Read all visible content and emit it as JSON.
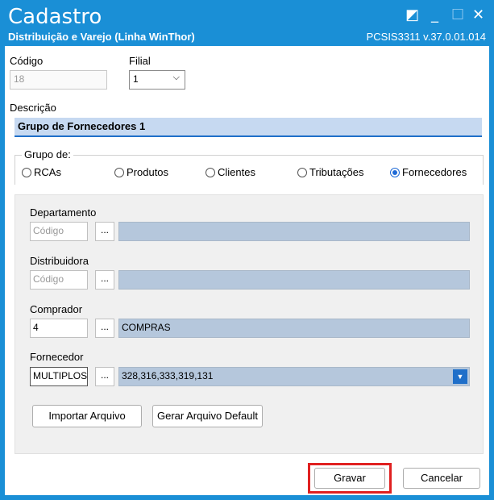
{
  "window": {
    "title": "Cadastro",
    "subtitle": "Distribuição e Varejo (Linha WinThor)",
    "version": "PCSIS3311  v.37.0.01.014"
  },
  "form": {
    "codigo_label": "Código",
    "codigo_value": "18",
    "filial_label": "Filial",
    "filial_value": "1",
    "descricao_label": "Descrição",
    "descricao_value": "Grupo  de Fornecedores 1",
    "grupo_label": "Grupo de:",
    "radios": [
      {
        "label": "RCAs",
        "checked": false
      },
      {
        "label": "Produtos",
        "checked": false
      },
      {
        "label": "Clientes",
        "checked": false
      },
      {
        "label": "Tributações",
        "checked": false
      },
      {
        "label": "Fornecedores",
        "checked": true
      }
    ]
  },
  "panel": {
    "departamento_label": "Departamento",
    "departamento_code_placeholder": "Código",
    "departamento_name": "",
    "distribuidora_label": "Distribuidora",
    "distribuidora_code_placeholder": "Código",
    "distribuidora_name": "",
    "comprador_label": "Comprador",
    "comprador_code": "4",
    "comprador_name": "COMPRAS",
    "fornecedor_label": "Fornecedor",
    "fornecedor_code": "MULTIPLOS",
    "fornecedor_name": "328,316,333,319,131",
    "dots": "...",
    "importar_label": "Importar Arquivo",
    "gerar_label": "Gerar Arquivo Default"
  },
  "footer": {
    "gravar_label": "Gravar",
    "cancelar_label": "Cancelar"
  },
  "colors": {
    "titlebar": "#1a8fd6",
    "accent": "#1e6ad6",
    "highlight": "#e02020"
  }
}
